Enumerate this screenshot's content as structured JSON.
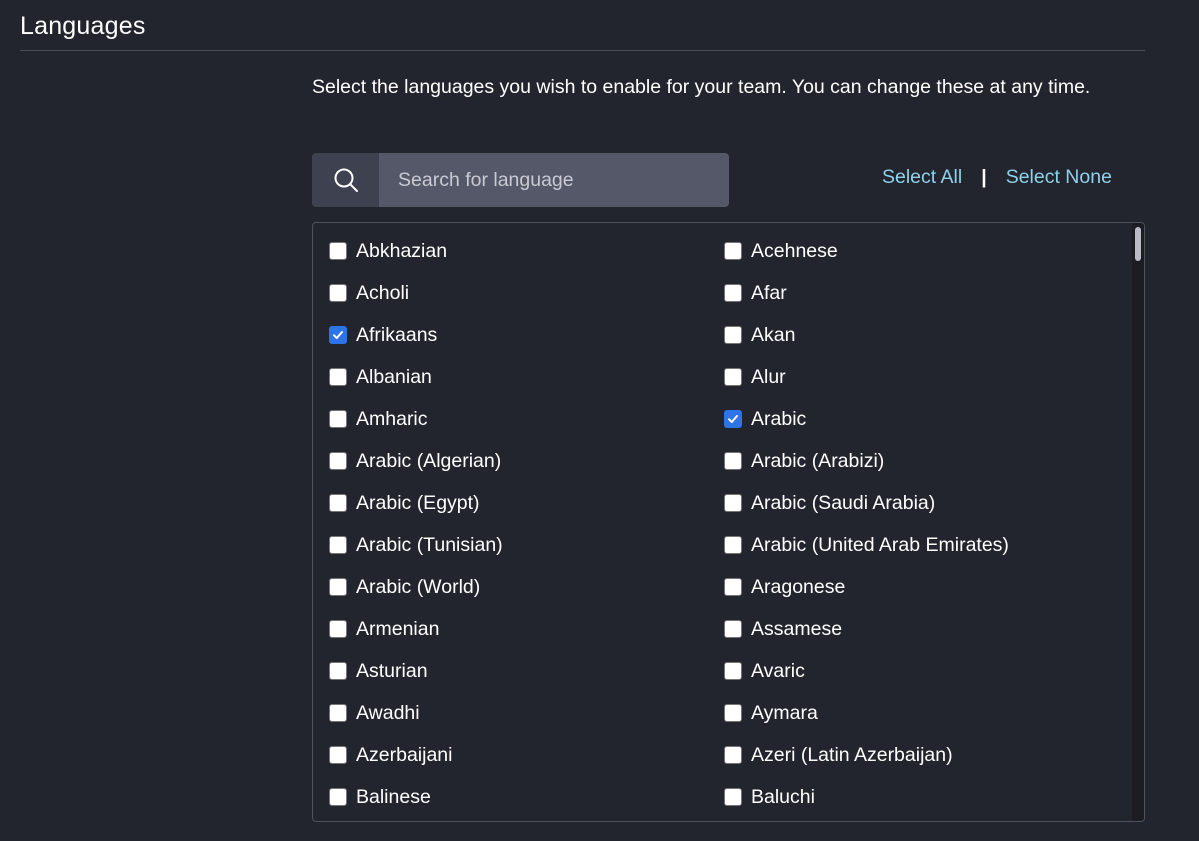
{
  "section": {
    "title": "Languages",
    "description": "Select the languages you wish to enable for your team. You can change these at any time."
  },
  "search": {
    "placeholder": "Search for language",
    "value": "",
    "icon": "search-icon"
  },
  "controls": {
    "select_all": "Select All",
    "separator": "|",
    "select_none": "Select None"
  },
  "colors": {
    "background": "#22252d",
    "link": "#8fd1ea",
    "checkbox_checked": "#2f74e6"
  },
  "languages": [
    {
      "label": "Abkhazian",
      "checked": false
    },
    {
      "label": "Acehnese",
      "checked": false
    },
    {
      "label": "Acholi",
      "checked": false
    },
    {
      "label": "Afar",
      "checked": false
    },
    {
      "label": "Afrikaans",
      "checked": true
    },
    {
      "label": "Akan",
      "checked": false
    },
    {
      "label": "Albanian",
      "checked": false
    },
    {
      "label": "Alur",
      "checked": false
    },
    {
      "label": "Amharic",
      "checked": false
    },
    {
      "label": "Arabic",
      "checked": true
    },
    {
      "label": "Arabic (Algerian)",
      "checked": false
    },
    {
      "label": "Arabic (Arabizi)",
      "checked": false
    },
    {
      "label": "Arabic (Egypt)",
      "checked": false
    },
    {
      "label": "Arabic (Saudi Arabia)",
      "checked": false
    },
    {
      "label": "Arabic (Tunisian)",
      "checked": false
    },
    {
      "label": "Arabic (United Arab Emirates)",
      "checked": false
    },
    {
      "label": "Arabic (World)",
      "checked": false
    },
    {
      "label": "Aragonese",
      "checked": false
    },
    {
      "label": "Armenian",
      "checked": false
    },
    {
      "label": "Assamese",
      "checked": false
    },
    {
      "label": "Asturian",
      "checked": false
    },
    {
      "label": "Avaric",
      "checked": false
    },
    {
      "label": "Awadhi",
      "checked": false
    },
    {
      "label": "Aymara",
      "checked": false
    },
    {
      "label": "Azerbaijani",
      "checked": false
    },
    {
      "label": "Azeri (Latin Azerbaijan)",
      "checked": false
    },
    {
      "label": "Balinese",
      "checked": false
    },
    {
      "label": "Baluchi",
      "checked": false
    }
  ]
}
